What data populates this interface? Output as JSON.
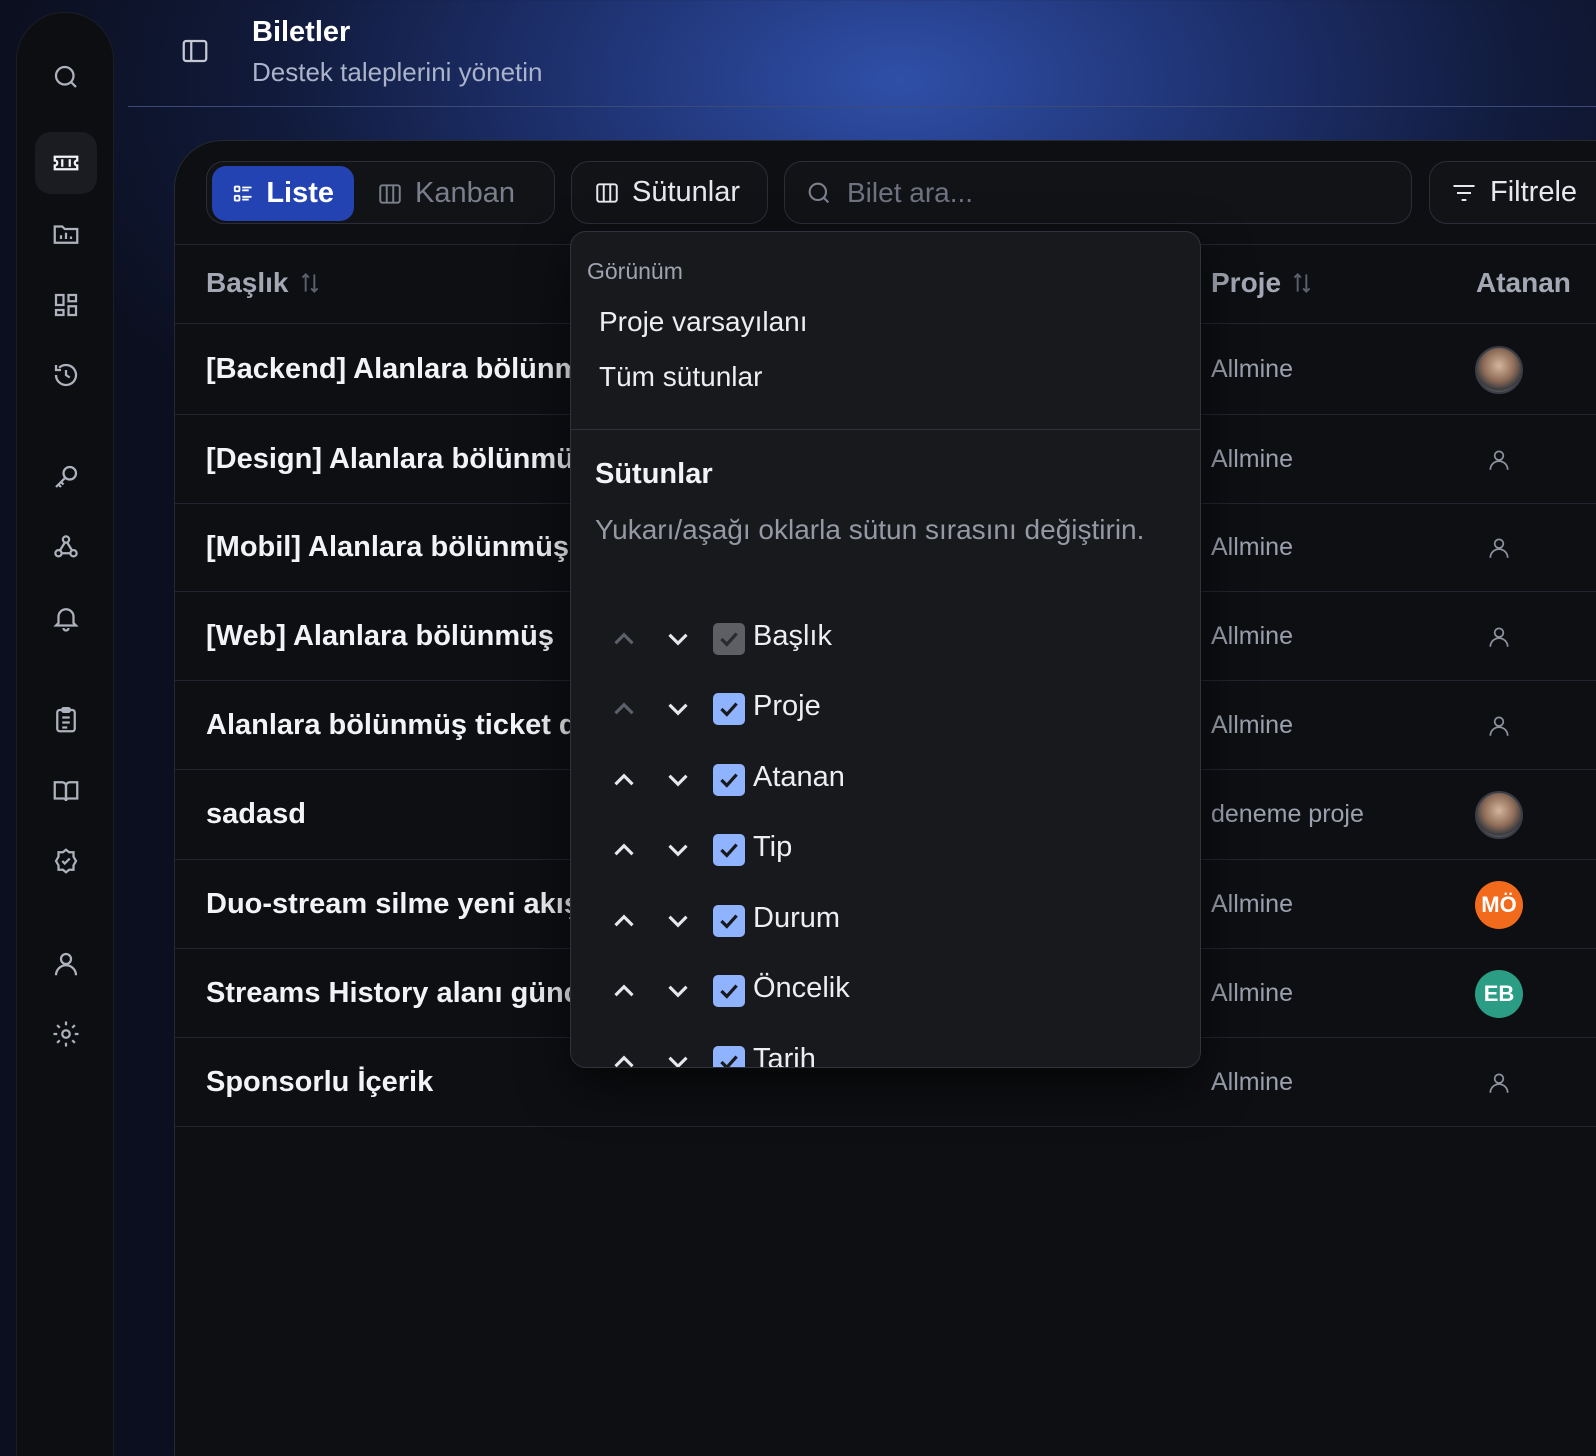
{
  "header": {
    "title": "Biletler",
    "subtitle": "Destek taleplerini yönetin"
  },
  "rail": {
    "items": [
      "search-icon",
      "ticket-icon",
      "folder-chart-icon",
      "dashboard-icon",
      "history-icon",
      "key-icon",
      "webhook-icon",
      "bell-icon",
      "clipboard-icon",
      "book-icon",
      "badge-icon",
      "user-icon",
      "settings-icon"
    ],
    "active": "ticket-icon"
  },
  "toolbar": {
    "list_label": "Liste",
    "kanban_label": "Kanban",
    "columns_label": "Sütunlar",
    "search_placeholder": "Bilet ara...",
    "filter_label": "Filtrele"
  },
  "table": {
    "columns": {
      "title": "Başlık",
      "project": "Proje",
      "assignee": "Atanan"
    },
    "rows": [
      {
        "title": "[Backend] Alanlara bölünmüş",
        "project": "Allmine",
        "assignee": "photo"
      },
      {
        "title": "[Design] Alanlara bölünmüş",
        "project": "Allmine",
        "assignee": "none"
      },
      {
        "title": "[Mobil] Alanlara bölünmüş",
        "project": "Allmine",
        "assignee": "none"
      },
      {
        "title": "[Web] Alanlara bölünmüş",
        "project": "Allmine",
        "assignee": "none"
      },
      {
        "title": "Alanlara bölünmüş ticket d",
        "project": "Allmine",
        "assignee": "none"
      },
      {
        "title": "sadasd",
        "project": "deneme proje",
        "assignee": "photo"
      },
      {
        "title": "Duo-stream silme yeni akış",
        "project": "Allmine",
        "assignee": "MÖ"
      },
      {
        "title": "Streams History alanı günc",
        "project": "Allmine",
        "assignee": "EB"
      },
      {
        "title": "Sponsorlu İçerik",
        "project": "Allmine",
        "assignee": "none"
      }
    ]
  },
  "columns_menu": {
    "view_label": "Görünüm",
    "view_options": [
      "Proje varsayılanı",
      "Tüm sütunlar"
    ],
    "heading": "Sütunlar",
    "hint": "Yukarı/aşağı oklarla sütun sırasını değiştirin.",
    "columns": [
      {
        "label": "Başlık",
        "checked": true,
        "locked": true
      },
      {
        "label": "Proje",
        "checked": true,
        "locked": false
      },
      {
        "label": "Atanan",
        "checked": true,
        "locked": false
      },
      {
        "label": "Tip",
        "checked": true,
        "locked": false
      },
      {
        "label": "Durum",
        "checked": true,
        "locked": false
      },
      {
        "label": "Öncelik",
        "checked": true,
        "locked": false
      },
      {
        "label": "Tarih",
        "checked": true,
        "locked": false
      }
    ]
  },
  "colors": {
    "accent": "#2443b3",
    "checkbox": "#8fb3ff",
    "avatar_mo": "#f26a1b",
    "avatar_eb": "#2a9d84"
  }
}
